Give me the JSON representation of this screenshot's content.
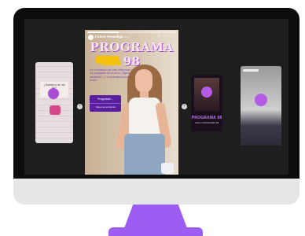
{
  "story": {
    "account": "Future Homeligo",
    "age": "1 sem",
    "controls": "Ⅱ ◁ ⋯",
    "title": "PROGRAMA 98",
    "question_text": "En el comienzo de Inés! influencias de los programas de los años ¿Sigues sí afectando? ¿Y a mi familia conoce el tema?",
    "card_button": "Pregúntale...",
    "card_footer": "Sigue aprendiendo",
    "progress": 0.35
  },
  "thumbnails": {
    "left": {
      "card_text": "¿Sabías lo de los 90?"
    },
    "right1": {
      "title": "PROGRAMA 98",
      "subtitle": "Sobre PROGRAMA 98"
    }
  },
  "nav": {
    "prev_icon": "‹",
    "next_icon": "›"
  },
  "colors": {
    "accent": "#9d5cf2",
    "title_shadow": "#a34cd6"
  }
}
